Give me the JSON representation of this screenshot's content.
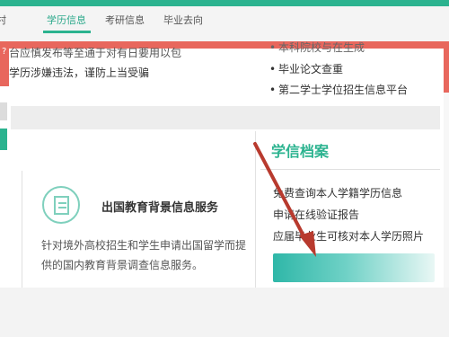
{
  "nav": {
    "items": [
      {
        "label": "学历信息",
        "active": true
      },
      {
        "label": "考研信息",
        "active": false
      },
      {
        "label": "毕业去向",
        "active": false
      }
    ],
    "first_partial": "村"
  },
  "news": {
    "line1": "台应慎发布等至通于对有日要用以包",
    "line2": "学历涉嫌违法，谨防上当受骗",
    "badge": "?"
  },
  "right_list": {
    "items": [
      "毕业论文查重",
      "第二学士学位招生信息平台"
    ],
    "partial_top": "本科院校与在生成"
  },
  "service_card": {
    "title": "出国教育背景信息服务",
    "description": "针对境外高校招生和学生申请出国留学而提供的国内教育背景调查信息服务。"
  },
  "archive": {
    "title": "学信档案",
    "links": [
      "免费查询本人学籍学历信息",
      "申请在线验证报告",
      "应届毕业生可核对本人学历照片"
    ]
  },
  "colors": {
    "teal": "#2bb38f",
    "red": "#e8675d",
    "arrow": "#c0392b"
  }
}
